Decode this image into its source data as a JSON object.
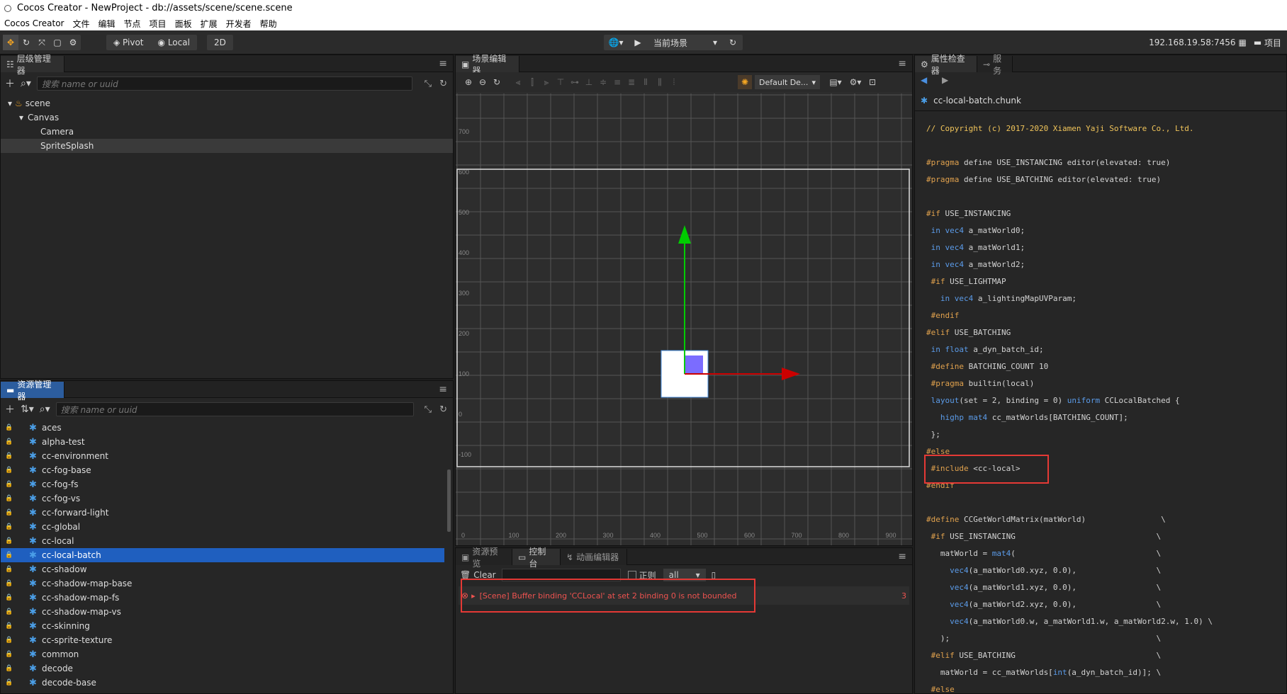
{
  "window": {
    "title": "Cocos Creator - NewProject - db://assets/scene/scene.scene"
  },
  "menu": [
    "Cocos Creator",
    "文件",
    "编辑",
    "节点",
    "项目",
    "面板",
    "扩展",
    "开发者",
    "帮助"
  ],
  "toolbar": {
    "pivot": "Pivot",
    "local": "Local",
    "mode2d": "2D",
    "scene_select": "当前场景",
    "ip": "192.168.19.58:7456",
    "project": "项目"
  },
  "hierarchy": {
    "tab": "层级管理器",
    "search_placeholder": "搜索 name or uuid",
    "nodes": [
      {
        "label": "scene",
        "depth": 0
      },
      {
        "label": "Canvas",
        "depth": 1
      },
      {
        "label": "Camera",
        "depth": 2
      },
      {
        "label": "SpriteSplash",
        "depth": 2,
        "selected": true
      }
    ]
  },
  "assets": {
    "tab": "资源管理器",
    "search_placeholder": "搜索 name or uuid",
    "items": [
      "aces",
      "alpha-test",
      "cc-environment",
      "cc-fog-base",
      "cc-fog-fs",
      "cc-fog-vs",
      "cc-forward-light",
      "cc-global",
      "cc-local",
      "cc-local-batch",
      "cc-shadow",
      "cc-shadow-map-base",
      "cc-shadow-map-fs",
      "cc-shadow-map-vs",
      "cc-skinning",
      "cc-sprite-texture",
      "common",
      "decode",
      "decode-base"
    ],
    "selected_index": 9
  },
  "scene_editor": {
    "tab": "场景编辑器",
    "camera_select": "Default De...",
    "y_ticks": [
      "700",
      "600",
      "500",
      "400",
      "300",
      "200",
      "100",
      "0",
      "-100"
    ],
    "x_ticks": [
      "0",
      "100",
      "200",
      "300",
      "400",
      "500",
      "600",
      "700",
      "800",
      "900"
    ]
  },
  "console": {
    "tabs": [
      "资源预览",
      "控制台",
      "动画编辑器"
    ],
    "clear": "Clear",
    "regex": "正则",
    "filter": "all",
    "error_message": "[Scene] Buffer binding 'CCLocal' at set 2 binding 0 is not bounded",
    "error_count": "3"
  },
  "inspector": {
    "tabs": [
      "属性检查器",
      "服务"
    ],
    "file": "cc-local-batch.chunk",
    "code_lines": [
      "// Copyright (c) 2017-2020 Xiamen Yaji Software Co., Ltd.",
      "",
      "#pragma define USE_INSTANCING editor(elevated: true)",
      "#pragma define USE_BATCHING editor(elevated: true)",
      "",
      "#if USE_INSTANCING",
      " in vec4 a_matWorld0;",
      " in vec4 a_matWorld1;",
      " in vec4 a_matWorld2;",
      " #if USE_LIGHTMAP",
      "   in vec4 a_lightingMapUVParam;",
      " #endif",
      "#elif USE_BATCHING",
      " in float a_dyn_batch_id;",
      " #define BATCHING_COUNT 10",
      " #pragma builtin(local)",
      " layout(set = 2, binding = 0) uniform CCLocalBatched {",
      "   highp mat4 cc_matWorlds[BATCHING_COUNT];",
      " };",
      "#else",
      " #include <cc-local>",
      "#endif",
      "",
      "#define CCGetWorldMatrix(matWorld)                \\",
      " #if USE_INSTANCING                              \\",
      "   matWorld = mat4(                              \\",
      "     vec4(a_matWorld0.xyz, 0.0),                 \\",
      "     vec4(a_matWorld1.xyz, 0.0),                 \\",
      "     vec4(a_matWorld2.xyz, 0.0),                 \\",
      "     vec4(a_matWorld0.w, a_matWorld1.w, a_matWorld2.w, 1.0) \\",
      "   );                                            \\",
      " #elif USE_BATCHING                              \\",
      "   matWorld = cc_matWorlds[int(a_dyn_batch_id)]; \\",
      " #else"
    ]
  }
}
